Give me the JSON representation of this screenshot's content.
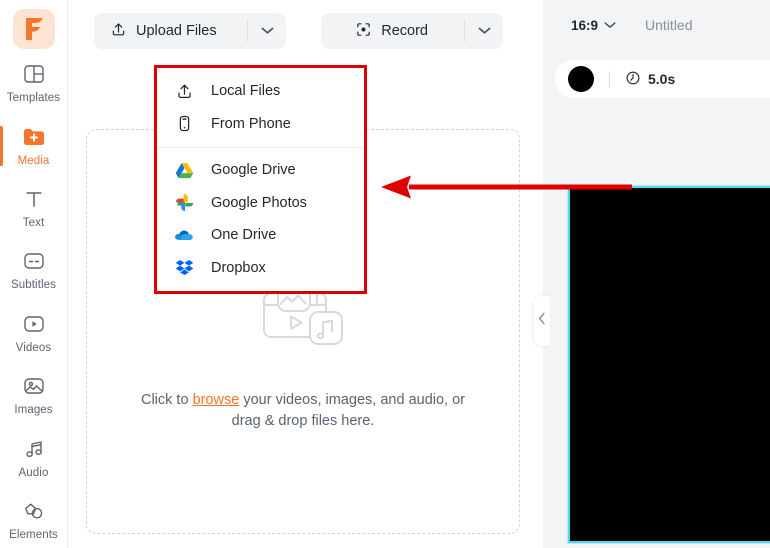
{
  "sidebar": {
    "logo": {
      "name": "flexclip-logo",
      "glyph": "F",
      "bg": "#fde4d2",
      "color": "#f2762e"
    },
    "items": [
      {
        "label": "Templates",
        "icon": "templates-icon",
        "active": false
      },
      {
        "label": "Media",
        "icon": "media-folder-plus-icon",
        "active": true
      },
      {
        "label": "Text",
        "icon": "text-t-icon",
        "active": false
      },
      {
        "label": "Subtitles",
        "icon": "subtitles-icon",
        "active": false
      },
      {
        "label": "Videos",
        "icon": "video-play-icon",
        "active": false
      },
      {
        "label": "Images",
        "icon": "image-icon",
        "active": false
      },
      {
        "label": "Audio",
        "icon": "audio-note-icon",
        "active": false
      },
      {
        "label": "Elements",
        "icon": "elements-shapes-icon",
        "active": false
      }
    ],
    "accent": "#f2762e"
  },
  "toolbar": {
    "upload": {
      "label": "Upload Files",
      "icon": "upload-arrow-icon",
      "caret": "chevron-down-icon"
    },
    "record": {
      "label": "Record",
      "icon": "record-target-icon",
      "caret": "chevron-down-icon"
    }
  },
  "upload_menu": {
    "highlight_color": "#e00000",
    "groups": [
      {
        "items": [
          {
            "label": "Local Files",
            "icon": "upload-arrow-icon"
          },
          {
            "label": "From Phone",
            "icon": "phone-icon"
          }
        ]
      },
      {
        "items": [
          {
            "label": "Google Drive",
            "icon": "google-drive-icon"
          },
          {
            "label": "Google Photos",
            "icon": "google-photos-icon"
          },
          {
            "label": "One Drive",
            "icon": "onedrive-icon"
          },
          {
            "label": "Dropbox",
            "icon": "dropbox-icon"
          }
        ]
      }
    ]
  },
  "dropzone": {
    "icon": "media-placeholder-icon",
    "text_before": "Click to ",
    "link": "browse",
    "text_after": " your videos, images, and audio, or drag & drop files here."
  },
  "annotation": {
    "arrow": {
      "name": "red-arrow",
      "color": "#e00000",
      "direction": "left"
    }
  },
  "collapse_handle": {
    "name": "panel-collapse-handle",
    "icon": "chevron-left-icon"
  },
  "right_panel": {
    "aspect_ratio": "16:9",
    "ratio_caret": "chevron-down-icon",
    "project_title": "Untitled",
    "clip": {
      "duration": "5.0s",
      "clock_icon": "clock-icon",
      "thumb": "black-clip-thumbnail"
    },
    "preview": {
      "name": "video-preview-canvas",
      "border_color": "#4fd8f0",
      "fill": "#000000"
    }
  }
}
